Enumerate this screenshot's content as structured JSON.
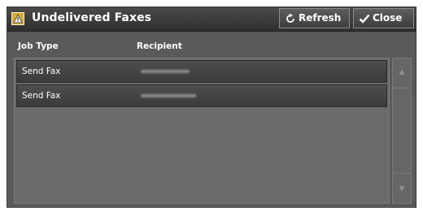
{
  "dialog": {
    "title": "Undelivered Faxes",
    "icon": "warning-icon",
    "refresh_label": "Refresh",
    "close_label": "Close"
  },
  "table": {
    "columns": [
      "Job Type",
      "Recipient"
    ],
    "rows": [
      {
        "job_type": "Send Fax",
        "recipient": "[redacted]"
      },
      {
        "job_type": "Send Fax",
        "recipient": "[redacted]"
      }
    ]
  },
  "scrollbar": {
    "up_icon": "scroll-up-icon",
    "down_icon": "scroll-down-icon"
  },
  "colors": {
    "panel_bg": "#5a5a5a",
    "titlebar_bg": "#2f2f2f",
    "row_bg": "#444444",
    "warning_icon": "#d1aa3b"
  }
}
